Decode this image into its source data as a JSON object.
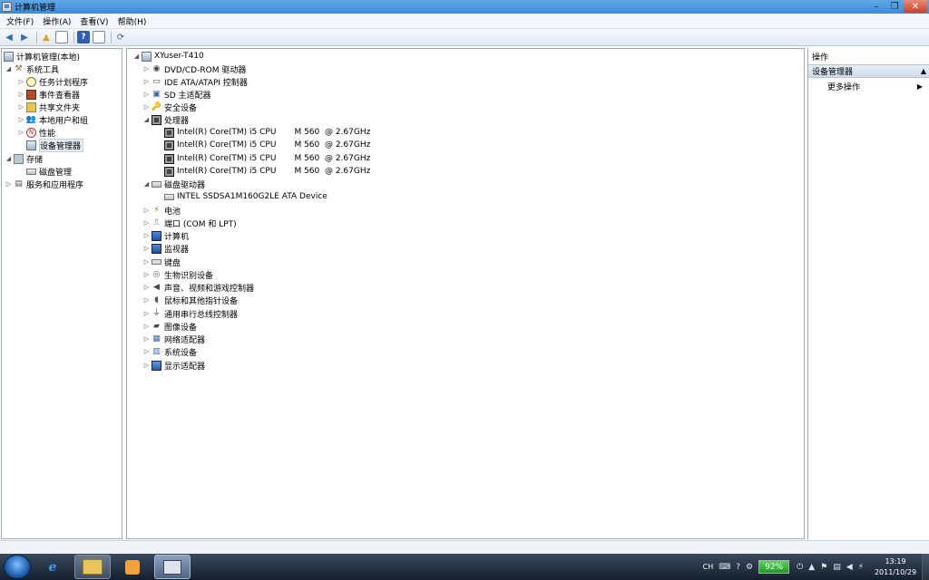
{
  "window": {
    "title": "计算机管理"
  },
  "menubar": [
    "文件(F)",
    "操作(A)",
    "查看(V)",
    "帮助(H)"
  ],
  "tree": {
    "root": "计算机管理(本地)",
    "system_tools": "系统工具",
    "system_children": [
      "任务计划程序",
      "事件查看器",
      "共享文件夹",
      "本地用户和组",
      "性能",
      "设备管理器"
    ],
    "storage": "存储",
    "disk_mgmt": "磁盘管理",
    "services": "服务和应用程序"
  },
  "devices": {
    "computer": "XYuser-T410",
    "items": {
      "dvd": "DVD/CD-ROM 驱动器",
      "ide": "IDE ATA/ATAPI 控制器",
      "sd": "SD 主适配器",
      "security": "安全设备",
      "processor": "处理器",
      "cpu": [
        "Intel(R) Core(TM) i5 CPU       M 560  @ 2.67GHz",
        "Intel(R) Core(TM) i5 CPU       M 560  @ 2.67GHz",
        "Intel(R) Core(TM) i5 CPU       M 560  @ 2.67GHz",
        "Intel(R) Core(TM) i5 CPU       M 560  @ 2.67GHz"
      ],
      "disk": "磁盘驱动器",
      "disk_child": "INTEL SSDSA1M160G2LE ATA Device",
      "battery": "电池",
      "ports": "端口 (COM 和 LPT)",
      "computer_cat": "计算机",
      "monitor": "监视器",
      "keyboard": "键盘",
      "biometric": "生物识别设备",
      "sound": "声音、视频和游戏控制器",
      "mouse": "鼠标和其他指针设备",
      "usb": "通用串行总线控制器",
      "imaging": "图像设备",
      "network": "网络适配器",
      "system": "系统设备",
      "display": "显示适配器"
    }
  },
  "actions": {
    "header": "操作",
    "section": "设备管理器",
    "more": "更多操作"
  },
  "taskbar": {
    "lang": "CH",
    "battery": "92%",
    "time": "13:19",
    "date": "2011/10/29"
  }
}
